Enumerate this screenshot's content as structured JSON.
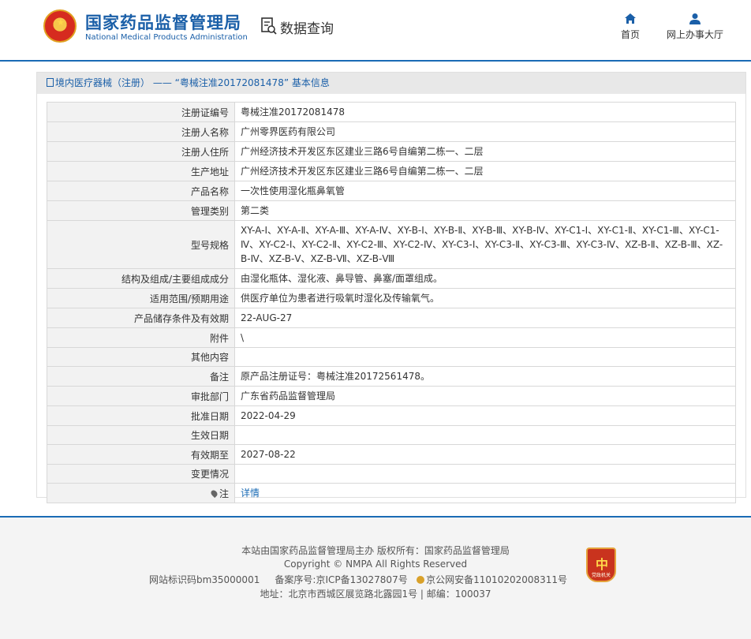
{
  "header": {
    "brand_cn": "国家药品监督管理局",
    "brand_en": "National Medical Products Administration",
    "query_label": "数据查询",
    "nav": [
      {
        "label": "首页",
        "icon": "home-icon"
      },
      {
        "label": "网上办事大厅",
        "icon": "user-icon"
      }
    ]
  },
  "panel": {
    "title": "境内医疗器械（注册） —— “粤械注准20172081478” 基本信息"
  },
  "rows": [
    {
      "label": "注册证编号",
      "value": "粤械注准20172081478"
    },
    {
      "label": "注册人名称",
      "value": "广州零界医药有限公司"
    },
    {
      "label": "注册人住所",
      "value": "广州经济技术开发区东区建业三路6号自编第二栋一、二层"
    },
    {
      "label": "生产地址",
      "value": "广州经济技术开发区东区建业三路6号自编第二栋一、二层"
    },
    {
      "label": "产品名称",
      "value": "一次性使用湿化瓶鼻氧管"
    },
    {
      "label": "管理类别",
      "value": "第二类"
    },
    {
      "label": "型号规格",
      "value": "XY-A-Ⅰ、XY-A-Ⅱ、XY-A-Ⅲ、XY-A-Ⅳ、XY-B-Ⅰ、XY-B-Ⅱ、XY-B-Ⅲ、XY-B-Ⅳ、XY-C1-Ⅰ、XY-C1-Ⅱ、XY-C1-Ⅲ、XY-C1-Ⅳ、XY-C2-Ⅰ、XY-C2-Ⅱ、XY-C2-Ⅲ、XY-C2-Ⅳ、XY-C3-Ⅰ、XY-C3-Ⅱ、XY-C3-Ⅲ、XY-C3-Ⅳ、XZ-B-Ⅱ、XZ-B-Ⅲ、XZ-B-Ⅳ、XZ-B-Ⅴ、XZ-B-Ⅶ、XZ-B-Ⅷ"
    },
    {
      "label": "结构及组成/主要组成成分",
      "value": "由湿化瓶体、湿化液、鼻导管、鼻塞/面罩组成。"
    },
    {
      "label": "适用范围/预期用途",
      "value": "供医疗单位为患者进行吸氧时湿化及传输氧气。"
    },
    {
      "label": "产品储存条件及有效期",
      "value": "22-AUG-27"
    },
    {
      "label": "附件",
      "value": "\\"
    },
    {
      "label": "其他内容",
      "value": ""
    },
    {
      "label": "备注",
      "value": "原产品注册证号：粤械注准20172561478。"
    },
    {
      "label": "审批部门",
      "value": "广东省药品监督管理局"
    },
    {
      "label": "批准日期",
      "value": "2022-04-29"
    },
    {
      "label": "生效日期",
      "value": ""
    },
    {
      "label": "有效期至",
      "value": "2027-08-22"
    },
    {
      "label": "变更情况",
      "value": ""
    },
    {
      "label": "注",
      "value": "详情",
      "link": true
    }
  ],
  "footer": {
    "line1": "本站由国家药品监督管理局主办 版权所有：国家药品监督管理局",
    "line2": "Copyright © NMPA All Rights Reserved",
    "site_id": "网站标识码bm35000001",
    "icp": "备案序号:京ICP备13027807号",
    "police": "京公网安备11010202008311号",
    "line4": "地址：北京市西城区展览路北露园1号 | 邮编：100037",
    "badge_text": "党政机关"
  }
}
